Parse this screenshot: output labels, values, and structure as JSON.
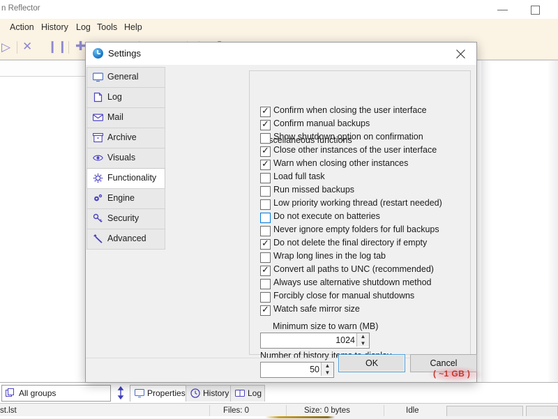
{
  "app": {
    "title": "n Reflector",
    "titlebar_buttons": [
      {
        "name": "minimize",
        "glyph": "minimize-icon"
      },
      {
        "name": "maximize",
        "glyph": "maximize-icon"
      }
    ],
    "menu": [
      "Action",
      "History",
      "Log",
      "Tools",
      "Help"
    ]
  },
  "tabs": {
    "group_combo": {
      "icon": "copy-icon",
      "value": "All groups"
    },
    "splitter": "vertical-resize-icon",
    "items": [
      {
        "label": "Properties",
        "icon": "monitor-icon",
        "active": true
      },
      {
        "label": "History",
        "icon": "clock-icon",
        "active": false
      },
      {
        "label": "Log",
        "icon": "book-icon",
        "active": false
      }
    ]
  },
  "status": {
    "file": "st.lst",
    "files": "Files: 0",
    "size": "Size: 0 bytes",
    "state": "Idle"
  },
  "dialog": {
    "title": "Settings",
    "icon": "clock-icon",
    "close_icon": "close-icon",
    "sidebar": [
      {
        "label": "General",
        "icon": "monitor-icon",
        "selected": false
      },
      {
        "label": "Log",
        "icon": "document-icon",
        "selected": false
      },
      {
        "label": "Mail",
        "icon": "envelope-icon",
        "selected": false
      },
      {
        "label": "Archive",
        "icon": "archive-icon",
        "selected": false
      },
      {
        "label": "Visuals",
        "icon": "eye-icon",
        "selected": false
      },
      {
        "label": "Functionality",
        "icon": "gear-sun-icon",
        "selected": true
      },
      {
        "label": "Engine",
        "icon": "gears-icon",
        "selected": false
      },
      {
        "label": "Security",
        "icon": "key-icon",
        "selected": false
      },
      {
        "label": "Advanced",
        "icon": "wrench-icon",
        "selected": false
      }
    ],
    "group_title": "Miscellaneous functions",
    "checkboxes": [
      {
        "label": "Confirm when closing the user interface",
        "checked": true,
        "focused": false
      },
      {
        "label": "Confirm manual backups",
        "checked": true,
        "focused": false
      },
      {
        "label": "Show shutdown option on confirmation",
        "checked": false,
        "focused": false
      },
      {
        "label": "Close other instances of the user interface",
        "checked": true,
        "focused": false
      },
      {
        "label": "Warn when closing other instances",
        "checked": true,
        "focused": false
      },
      {
        "label": "Load full task",
        "checked": false,
        "focused": false
      },
      {
        "label": "Run missed backups",
        "checked": false,
        "focused": false
      },
      {
        "label": "Low priority working thread (restart needed)",
        "checked": false,
        "focused": false
      },
      {
        "label": "Do not execute on batteries",
        "checked": false,
        "focused": true
      },
      {
        "label": "Never ignore empty folders for full backups",
        "checked": false,
        "focused": false
      },
      {
        "label": "Do not delete the final directory if empty",
        "checked": true,
        "focused": false
      },
      {
        "label": "Wrap long lines in the log tab",
        "checked": false,
        "focused": false
      },
      {
        "label": "Convert all paths to UNC (recommended)",
        "checked": true,
        "focused": false
      },
      {
        "label": "Always use alternative shutdown method",
        "checked": false,
        "focused": false
      },
      {
        "label": "Forcibly close for manual shutdowns",
        "checked": false,
        "focused": false
      },
      {
        "label": "Watch safe mirror size",
        "checked": true,
        "focused": false
      }
    ],
    "min_size_label": "Minimum size to warn (MB)",
    "min_size_value": "1024",
    "history_label": "Number of history items to display",
    "history_value": "50",
    "annotation": "( ~1 GB )",
    "annotation_color": "#c0392b",
    "ok_label": "OK",
    "cancel_label": "Cancel"
  },
  "colors": {
    "menu_bg": "#fbf3e4",
    "toolbar_icon": "#7b77c9",
    "sidebar_icon": "#4b42c4",
    "focus_blue": "#0078d7"
  }
}
